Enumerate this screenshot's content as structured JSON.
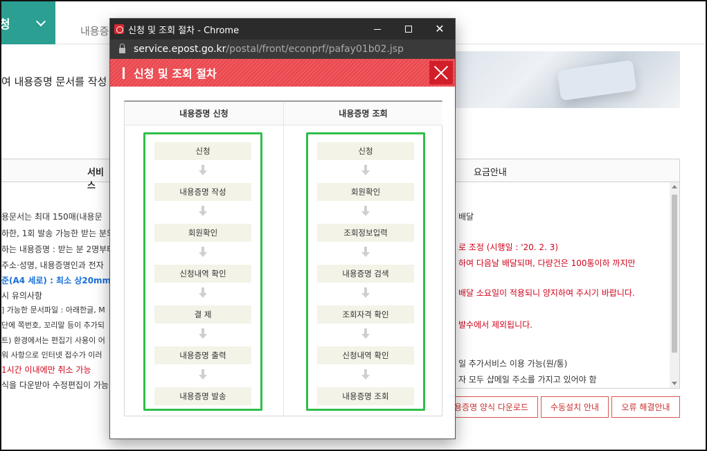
{
  "bg": {
    "apply_label": "청",
    "tab2": "내용증",
    "heading": "여 내용증명 문서를 작성 발송",
    "tab_left": "서비스",
    "tab_right": "요금안내",
    "left_lines": [
      "용문서는 최대 150매(내용문",
      "하한, 1회 발송 가능한 받는 분의",
      "하는 내용증명 : 받는 분 2명부터",
      "주소·성명, 내용증명인과 전자",
      "준(A4 세로) : 최소 상20mm,",
      "시 유의사항",
      "] 가능한 문서파일 : 아래한글, M",
      "단에 쪽번호, 꼬리말 등이 추가되",
      "트) 환경에서는 편집기 사용이 어",
      "워 사항으로 인터넷 접수가 이러",
      "1시간 이내에만 취소 가능",
      "식을 다운받아 수정편집이 가능"
    ],
    "right_lines": [
      "배달",
      "로 조정 (시행일 : '20. 2. 3)",
      "하여 다음날 배달되며, 다량건은 100통이하 까지만",
      "배달 소요일이 적용되니 양지하여 주시기 바랍니다.",
      "발수에서 제외됩니다.",
      "일 추가서비스 이용 가능(원/통)",
      "자 모두 샵메일 주소를 가지고 있어야 함"
    ],
    "buttons": [
      "용증명 양식 다운로드",
      "수동설치 안내",
      "오류 해결안내"
    ]
  },
  "window": {
    "title": "신청 및 조회 절차 - Chrome",
    "url_host": "service.epost.go.kr",
    "url_path": "/postal/front/econprf/pafay01b02.jsp"
  },
  "popup": {
    "title": "신청 및 조회 절차",
    "columns": [
      {
        "header": "내용증명 신청",
        "steps": [
          "신청",
          "내용증명 작성",
          "회원확인",
          "신청내역 확인",
          "결 제",
          "내용증명 출력",
          "내용증명 발송"
        ]
      },
      {
        "header": "내용증명 조회",
        "steps": [
          "신청",
          "회원확인",
          "조회정보입력",
          "내용증명 검색",
          "조회자격 확인",
          "신청내역 확인",
          "내용증명 조회"
        ]
      }
    ]
  },
  "colors": {
    "accent_red": "#e8474d",
    "highlight_green": "#2ebf4a",
    "teal": "#2a9f92"
  }
}
